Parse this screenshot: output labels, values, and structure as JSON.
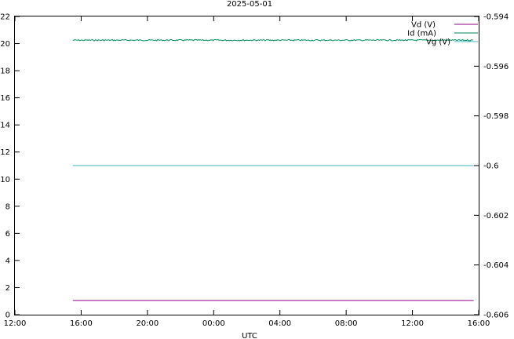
{
  "chart_data": {
    "type": "line",
    "title": "2025-05-01",
    "xlabel": "UTC",
    "ylabel": "",
    "y2label": "",
    "x_ticks": [
      "12:00",
      "16:00",
      "20:00",
      "00:00",
      "04:00",
      "08:00",
      "12:00",
      "16:00"
    ],
    "x_range_hours": [
      0,
      28
    ],
    "ylim": [
      0,
      22
    ],
    "y_ticks": [
      0,
      2,
      4,
      6,
      8,
      10,
      12,
      14,
      16,
      18,
      20,
      22
    ],
    "y2lim": [
      -0.606,
      -0.594
    ],
    "y2_ticks": [
      -0.606,
      -0.604,
      -0.602,
      -0.6,
      -0.598,
      -0.596,
      -0.594
    ],
    "y2_tick_labels": [
      "-0.606",
      "-0.604",
      "-0.602",
      "-0.6",
      "-0.598",
      "-0.596",
      "-0.594"
    ],
    "grid": false,
    "legend_position": "top-right",
    "series": [
      {
        "name": "Vd (V)",
        "axis": "y1",
        "color": "#94008f",
        "x": [
          3.5,
          27.7
        ],
        "values": [
          1.05,
          1.05
        ]
      },
      {
        "name": "Id (mA)",
        "axis": "y1",
        "color": "#008a60",
        "x": [
          3.5,
          27.7
        ],
        "values": [
          20.25,
          20.25
        ],
        "noisy": true
      },
      {
        "name": "Vg (V)",
        "axis": "y2",
        "color": "#40b4c6",
        "x": [
          3.5,
          27.7
        ],
        "values": [
          -0.6,
          -0.6
        ]
      }
    ]
  }
}
